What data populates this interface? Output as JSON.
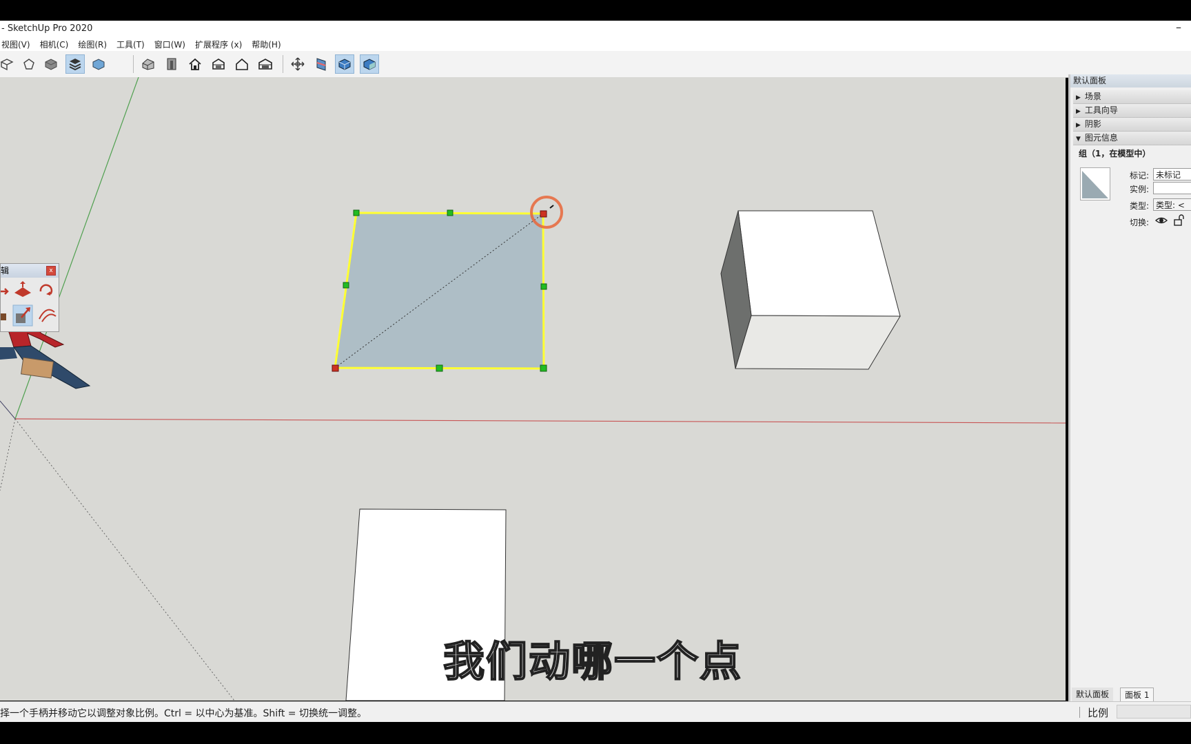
{
  "window": {
    "title": "- SketchUp Pro 2020",
    "minimize_glyph": "–"
  },
  "menu": {
    "items": [
      "视图(V)",
      "相机(C)",
      "绘图(R)",
      "工具(T)",
      "窗口(W)",
      "扩展程序 (x)",
      "帮助(H)"
    ]
  },
  "toolbar": {
    "icons": [
      "iso-view-icon",
      "top-view-icon",
      "shaded-icon",
      "layers-icon",
      "xray-icon",
      "house-iso-icon",
      "house-front-icon",
      "house-icon",
      "house-right-icon",
      "house-back-icon",
      "house-left-icon",
      "orbit-icon",
      "section-icon",
      "section-fill-icon",
      "section-cut-icon"
    ]
  },
  "edit_toolbar": {
    "title": "辑",
    "close_label": "x"
  },
  "default_panel": {
    "title": "默认面板",
    "sections": [
      {
        "label": "场景",
        "expanded": false
      },
      {
        "label": "工具向导",
        "expanded": false
      },
      {
        "label": "阴影",
        "expanded": false
      },
      {
        "label": "图元信息",
        "expanded": true
      }
    ],
    "entity_info": {
      "title": "组（1，在模型中）",
      "tag_label": "标记:",
      "tag_value": "未标记",
      "instance_label": "实例:",
      "instance_value": "",
      "type_label": "类型:",
      "type_value": "类型: <",
      "toggle_label": "切换:"
    },
    "tabs": [
      "默认面板",
      "面板 1"
    ]
  },
  "status": {
    "text": "择一个手柄并移动它以调整对象比例。Ctrl = 以中心为基准。Shift = 切换统一调整。",
    "measure_label": "比例",
    "measure_value": ""
  },
  "subtitle": "我们动哪一个点",
  "colors": {
    "viewport_bg": "#d9d9d5",
    "selection": "#ffff33",
    "grip_green": "#22bb22",
    "grip_red": "#cc3322",
    "cursor_ring": "#e8663a",
    "red_axis": "#c44",
    "green_axis": "#4a4"
  }
}
